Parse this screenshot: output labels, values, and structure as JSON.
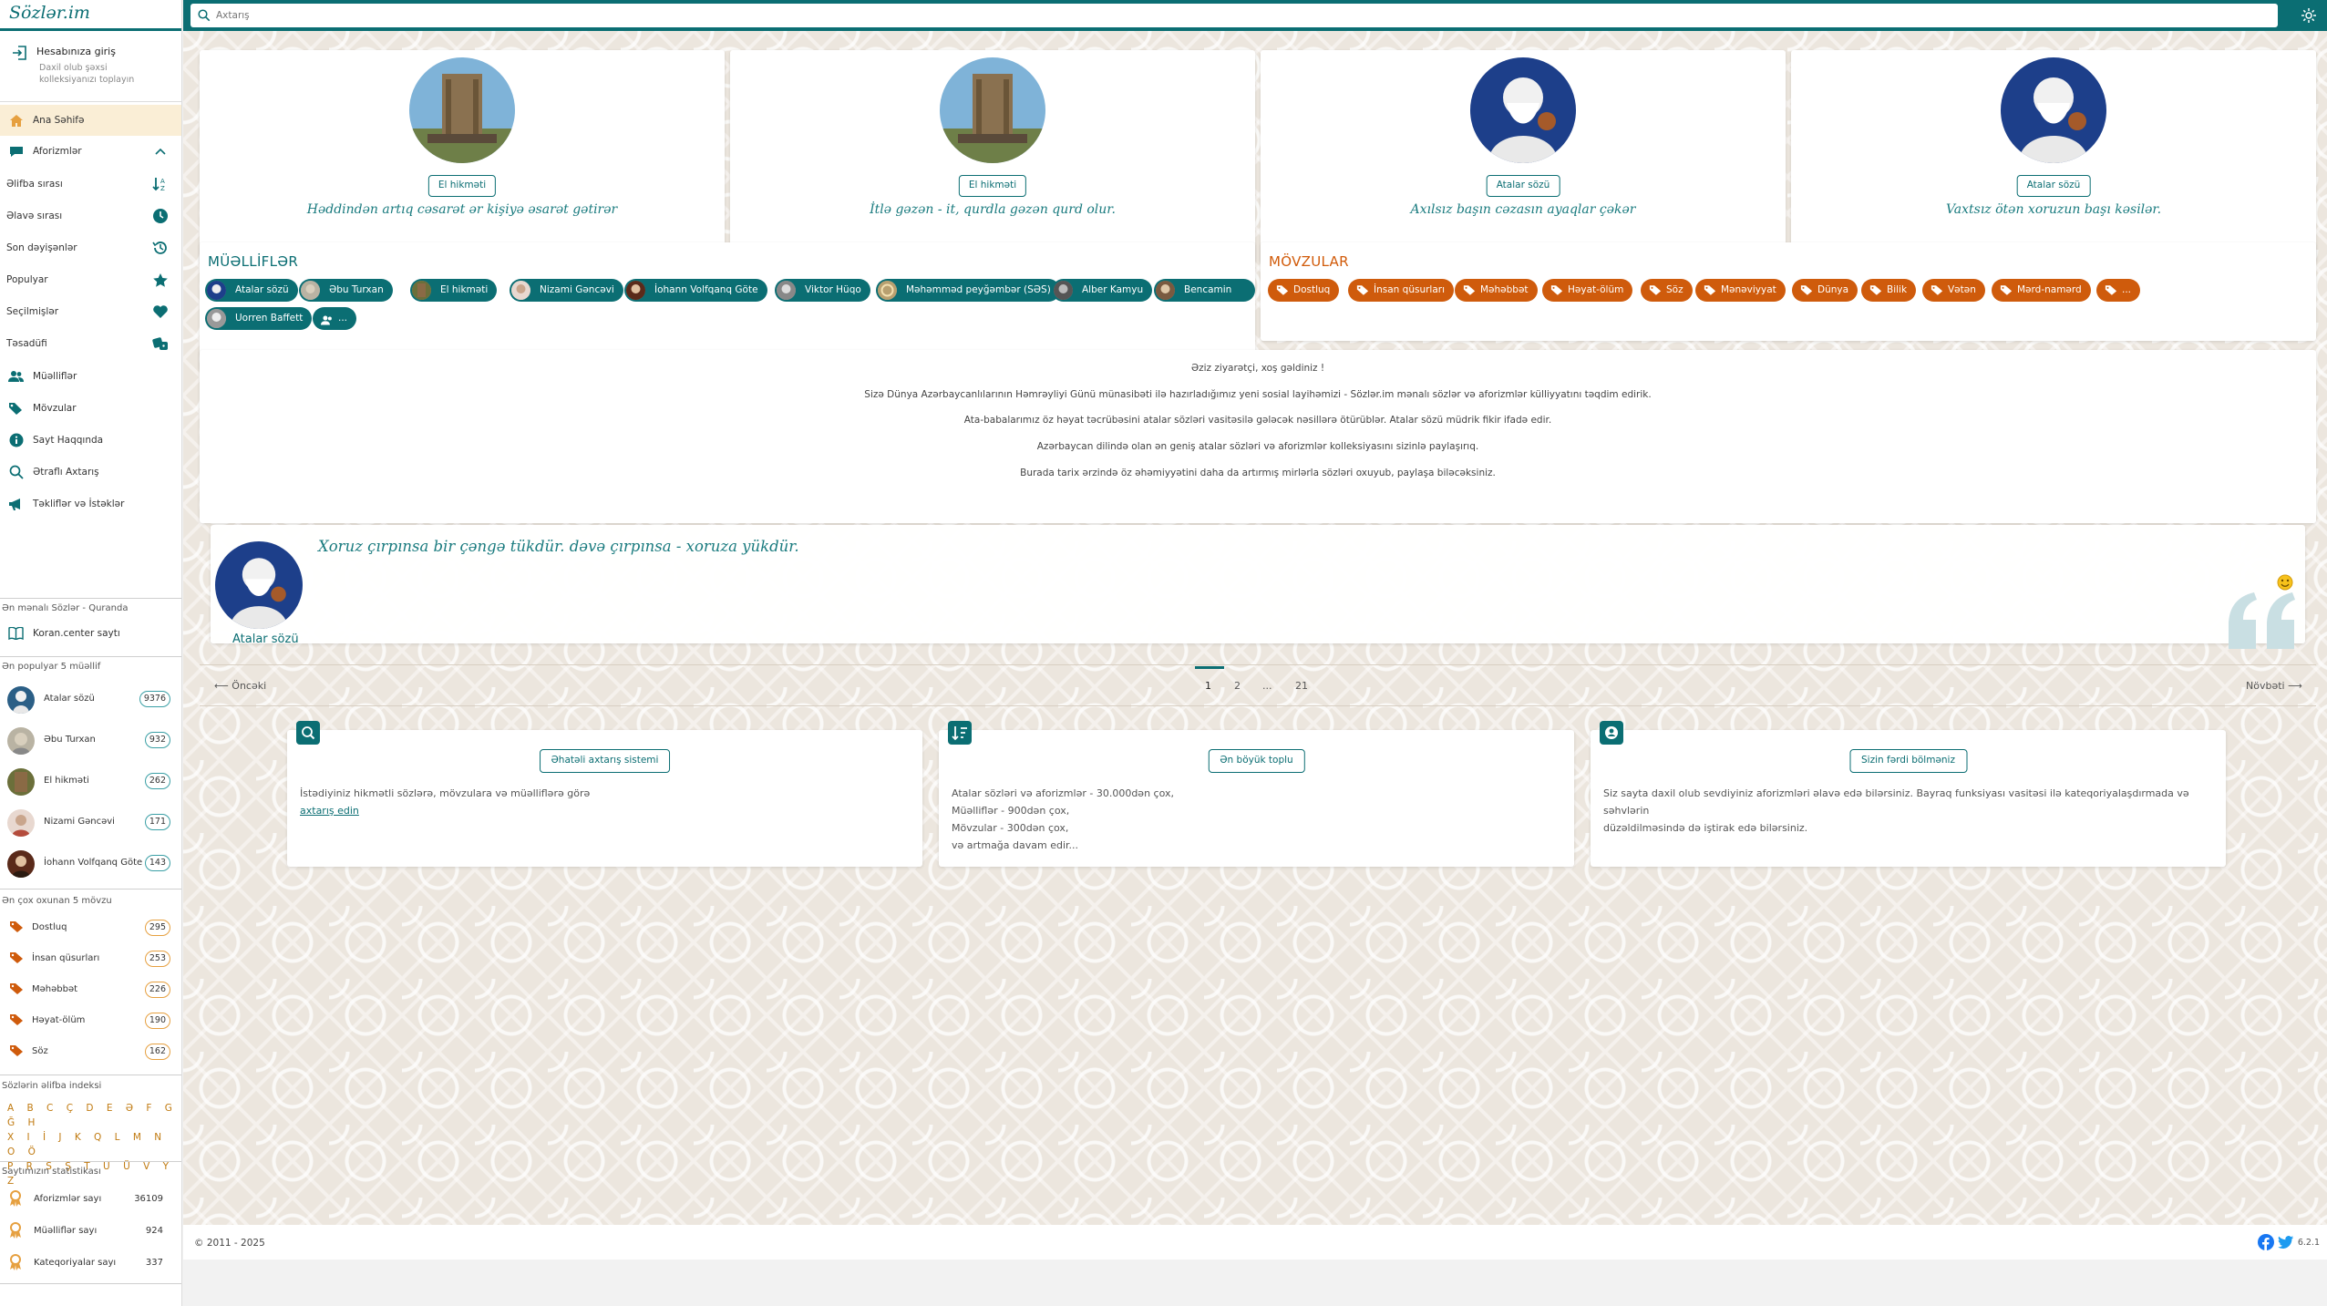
{
  "logo": "Sözlər.im",
  "login": {
    "title": "Hesabınıza giriş",
    "subtitle": "Daxil olub şəxsi kolleksiyanızı toplayın"
  },
  "nav": {
    "home": "Ana Səhifə",
    "aphorisms": "Aforizmlər",
    "sub": [
      "Əlifba sırası",
      "Əlavə sırası",
      "Son dəyişənlər",
      "Populyar",
      "Seçilmişlər",
      "Təsadüfi"
    ],
    "authors": "Müəlliflər",
    "topics": "Mövzular",
    "about": "Sayt Haqqında",
    "advanced_search": "Ətraflı Axtarış",
    "suggestions": "Təkliflər və İstəklər"
  },
  "quran": {
    "title": "Ən mənalı Sözlər - Quranda",
    "link": "Koran.center saytı"
  },
  "top_authors": {
    "title": "Ən populyar 5 müəllif",
    "items": [
      {
        "name": "Atalar sözü",
        "count": "9376"
      },
      {
        "name": "Əbu Turxan",
        "count": "932"
      },
      {
        "name": "El hikməti",
        "count": "262"
      },
      {
        "name": "Nizami Gəncəvi",
        "count": "171"
      },
      {
        "name": "İohann Volfqanq Göte",
        "count": "143"
      }
    ]
  },
  "top_topics": {
    "title": "Ən çox oxunan 5 mövzu",
    "items": [
      {
        "name": "Dostluq",
        "count": "295"
      },
      {
        "name": "İnsan qüsurları",
        "count": "253"
      },
      {
        "name": "Məhəbbət",
        "count": "226"
      },
      {
        "name": "Həyat-ölüm",
        "count": "190"
      },
      {
        "name": "Söz",
        "count": "162"
      }
    ]
  },
  "alphabet": {
    "title": "Sözlərin əlifba indeksi",
    "rows": [
      "A B C Ç D E Ə F G Ğ H",
      "X I İ J K Q L M N O Ö",
      "P R S Ş T U Ü V Y Z"
    ]
  },
  "stats": {
    "title": "Saytımızın statistikası",
    "items": [
      {
        "name": "Aforizmlər sayı",
        "value": "36109"
      },
      {
        "name": "Müəlliflər sayı",
        "value": "924"
      },
      {
        "name": "Kateqoriyalar sayı",
        "value": "337"
      }
    ]
  },
  "search": {
    "placeholder": "Axtarış"
  },
  "quote_cards": [
    {
      "author": "El hikməti",
      "text": "Həddindən artıq cəsarət ər kişiyə əsarət gətirər"
    },
    {
      "author": "El hikməti",
      "text": "İtlə gəzən - it, qurdla gəzən qurd olur."
    },
    {
      "author": "Atalar sözü",
      "text": "Axılsız başın cəzasın ayaqlar çəkər"
    },
    {
      "author": "Atalar sözü",
      "text": "Vaxtsız ötən xoruzun başı kəsilər."
    }
  ],
  "authors_section": {
    "title": "MÜƏLLİFLƏR",
    "items": [
      "Atalar sözü",
      "Əbu Turxan",
      "El hikməti",
      "Nizami Gəncəvi",
      "İohann Volfqanq Göte",
      "Viktor Hüqo",
      "Məhəmməd peyğəmbər (SƏS)",
      "Alber Kamyu",
      "Bencamin Franklin",
      "Uorren Baffett",
      "..."
    ]
  },
  "topics_section": {
    "title": "MÖVZULAR",
    "items": [
      "Dostluq",
      "İnsan qüsurları",
      "Məhəbbət",
      "Həyat-ölüm",
      "Söz",
      "Mənəviyyat",
      "Dünya",
      "Bilik",
      "Vətən",
      "Mərd-namərd",
      "..."
    ]
  },
  "welcome": [
    "Əziz ziyarətçi, xoş gəldiniz !",
    "Sizə Dünya Azərbaycanlılarının Həmrəyliyi Günü münasibəti ilə hazırladığımız yeni sosial layihəmizi - Sözlər.im mənalı sözlər və aforizmlər külliyyatını təqdim edirik.",
    "Ata-babalarımız öz həyat təcrübəsini atalar sözləri vasitəsilə gələcək nəsillərə ötürüblər. Atalar sözü müdrik fikir ifadə edir.",
    "Azərbaycan dilində olan ən geniş atalar sözləri və aforizmlər kolleksiyasını sizinlə paylaşırıq.",
    "Burada tarix ərzində öz əhəmiyyətini daha da artırmış mirlərla sözləri oxuyub, paylaşa biləcəksiniz."
  ],
  "featured_quote": {
    "text": "Xoruz çırpınsa bir çəngə tükdür. dəvə çırpınsa - xoruza yükdür.",
    "author": "Atalar sözü"
  },
  "pager": {
    "prev": "Öncəki",
    "next": "Növbəti",
    "pages": [
      "1",
      "2",
      "...",
      "21"
    ]
  },
  "features": [
    {
      "button": "Əhatəli axtarış sistemi",
      "lines": [
        "İstədiyiniz hikmətli sözlərə, mövzulara və müəlliflərə görə"
      ],
      "link": "axtarış edin"
    },
    {
      "button": "Ən böyük toplu",
      "lines": [
        "Atalar sözləri və aforizmlər - 30.000dən çox,",
        "Müəlliflər - 900dən çox,",
        "Mövzular - 300dən çox,",
        "və artmağa davam edir..."
      ],
      "link": ""
    },
    {
      "button": "Sizin fərdi bölməniz",
      "lines": [
        "Siz sayta daxil olub sevdiyiniz aforizmləri əlavə edə bilərsiniz. Bayraq funksiyası vasitəsi ilə kateqoriyalaşdırmada və səhvlərin",
        "düzəldilməsində də iştirak edə bilərsiniz."
      ],
      "link": ""
    }
  ],
  "footer": {
    "copyright": "© 2011 - 2025",
    "version": "6.2.1"
  },
  "colors": {
    "primary": "#0b6e73",
    "accent": "#cf5b0c",
    "active_bg": "#faeed6"
  }
}
